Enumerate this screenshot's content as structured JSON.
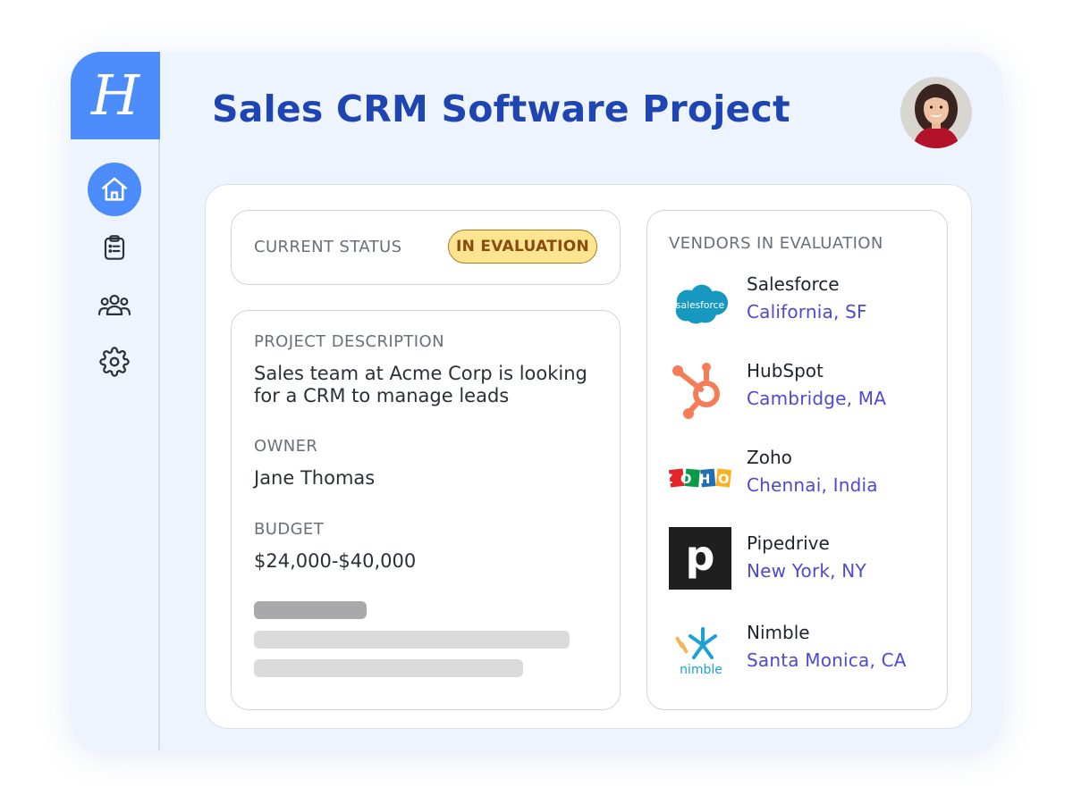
{
  "logo": {
    "letter": "H"
  },
  "header": {
    "title": "Sales CRM Software Project"
  },
  "sidebar": {
    "items": [
      {
        "icon": "home-icon",
        "active": true
      },
      {
        "icon": "clipboard-icon",
        "active": false
      },
      {
        "icon": "users-icon",
        "active": false
      },
      {
        "icon": "gear-icon",
        "active": false
      }
    ]
  },
  "status": {
    "label": "CURRENT STATUS",
    "badge": "IN EVALUATION"
  },
  "project": {
    "description_label": "PROJECT DESCRIPTION",
    "description": "Sales team at Acme Corp is looking for a CRM to manage leads",
    "owner_label": "OWNER",
    "owner": "Jane Thomas",
    "budget_label": "BUDGET",
    "budget": "$24,000-$40,000"
  },
  "vendors": {
    "label": "VENDORS IN EVALUATION",
    "items": [
      {
        "name": "Salesforce",
        "location": "California, SF",
        "logo_text": "salesforce"
      },
      {
        "name": "HubSpot",
        "location": "Cambridge, MA"
      },
      {
        "name": "Zoho",
        "location": "Chennai, India",
        "logo_text": "ZOHO"
      },
      {
        "name": "Pipedrive",
        "location": "New York, NY",
        "logo_text": "p"
      },
      {
        "name": "Nimble",
        "location": "Santa Monica, CA",
        "logo_text": "nimble"
      }
    ]
  },
  "colors": {
    "accent": "#4c8dfb",
    "title": "#1f45b3",
    "badge_bg": "#fde491",
    "badge_text": "#8a4b0f",
    "location_link": "#4f49d1"
  }
}
